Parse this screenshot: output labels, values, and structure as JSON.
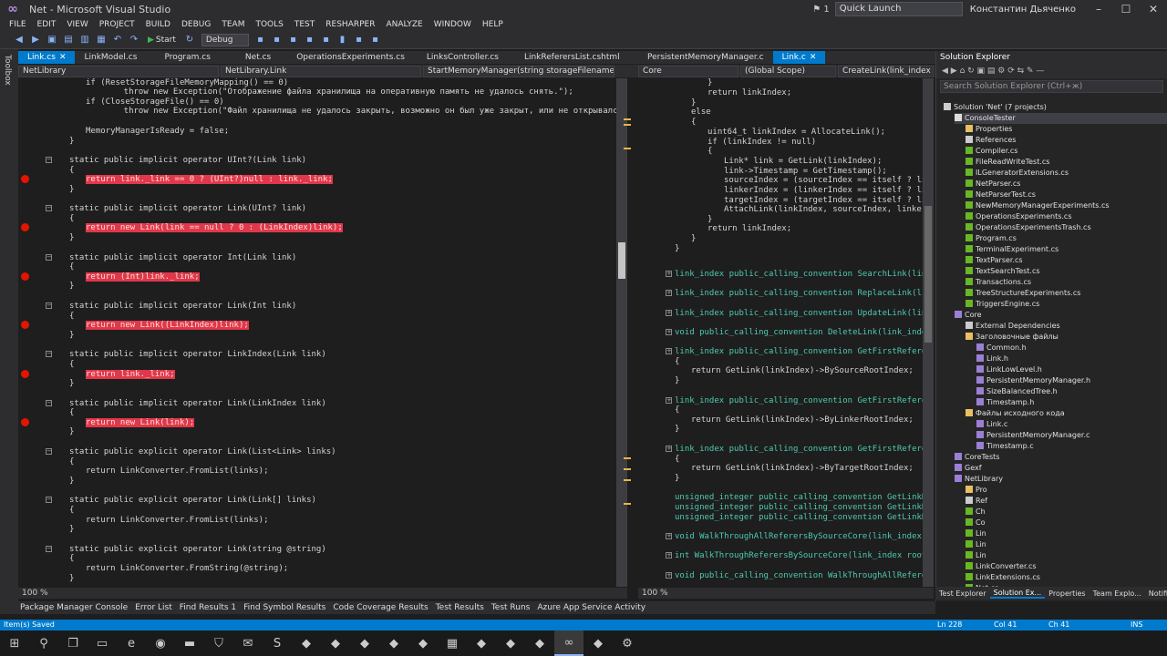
{
  "window": {
    "title": "Net - Microsoft Visual Studio",
    "notifications": "1",
    "quick_launch": "Quick Launch",
    "user": "Константин Дьяченко",
    "min": "–",
    "max": "☐",
    "close": "✕"
  },
  "menu": [
    "FILE",
    "EDIT",
    "VIEW",
    "PROJECT",
    "BUILD",
    "DEBUG",
    "TEAM",
    "TOOLS",
    "TEST",
    "RESHARPER",
    "ANALYZE",
    "WINDOW",
    "HELP"
  ],
  "toolbar": {
    "start_label": "Start",
    "config": "Debug"
  },
  "toolbox_label": "Toolbox",
  "left_tabs": [
    {
      "label": "Link.cs",
      "active": true
    },
    {
      "label": "LinkModel.cs",
      "active": false
    },
    {
      "label": "Program.cs",
      "active": false
    },
    {
      "label": "Net.cs",
      "active": false
    },
    {
      "label": "OperationsExperiments.cs",
      "active": false
    },
    {
      "label": "LinksController.cs",
      "active": false
    },
    {
      "label": "LinkReferersList.cshtml",
      "active": false
    }
  ],
  "left_nav": {
    "project": "NetLibrary",
    "type": "NetLibrary.Link",
    "member": "StartMemoryManager(string storageFilename)"
  },
  "right_tabs": [
    {
      "label": "PersistentMemoryManager.c",
      "active": false
    },
    {
      "label": "Link.c",
      "active": true
    }
  ],
  "right_nav": {
    "project": "Core",
    "scope": "(Global Scope)",
    "member": "CreateLink(link_index so"
  },
  "left_code": [
    "if (ResetStorageFileMemoryMapping() == 0)",
    "    throw new Exception(\"Отображение файла хранилища на оперативную память не удалось снять.\");",
    "if (CloseStorageFile() == 0)",
    "    throw new Exception(\"Файл хранилища не удалось закрыть, возможно он был уже закрыт, или не открывался вовсе.\");",
    "MemoryManagerIsReady = false;",
    "}",
    "static public implicit operator UInt?(Link link)",
    "{",
    "return link._link == 0 ? (UInt?)null : link._link;",
    "}",
    "static public implicit operator Link(UInt? link)",
    "{",
    "return new Link(link == null ? 0 : (LinkIndex)link);",
    "}",
    "static public implicit operator Int(Link link)",
    "{",
    "return (Int)link._link;",
    "}",
    "static public implicit operator Link(Int link)",
    "{",
    "return new Link((LinkIndex)link);",
    "}",
    "static public implicit operator LinkIndex(Link link)",
    "{",
    "return link._link;",
    "}",
    "static public implicit operator Link(LinkIndex link)",
    "{",
    "return new Link(link);",
    "}",
    "static public explicit operator Link(List<Link> links)",
    "{",
    "return LinkConverter.FromList(links);",
    "}",
    "static public explicit operator Link(Link[] links)",
    "{",
    "return LinkConverter.FromList(links);",
    "}",
    "static public explicit operator Link(string @string)",
    "{",
    "return LinkConverter.FromString(@string);",
    "}"
  ],
  "right_code": [
    "}",
    "return linkIndex;",
    "}",
    "else",
    "{",
    "uint64_t linkIndex = AllocateLink();",
    "if (linkIndex != null)",
    "{",
    "Link* link = GetLink(linkIndex);",
    "link->Timestamp = GetTimestamp();",
    "sourceIndex = (sourceIndex == itself ? linkInd",
    "linkerIndex = (linkerIndex == itself ? linkInd",
    "targetIndex = (targetIndex == itself ? linkInd",
    "AttachLink(linkIndex, sourceIndex, linkerIndex",
    "}",
    "return linkIndex;",
    "}",
    "}",
    "link_index public_calling_convention SearchLink(link_index",
    "link_index public_calling_convention ReplaceLink(link_inde",
    "link_index public_calling_convention UpdateLink(link_index",
    "void public_calling_convention DeleteLink(link_index linkI",
    "link_index public_calling_convention GetFirstRefererBySour",
    "{",
    "return GetLink(linkIndex)->BySourceRootIndex;",
    "}",
    "link_index public_calling_convention GetFirstRefererByLink",
    "{",
    "return GetLink(linkIndex)->ByLinkerRootIndex;",
    "}",
    "link_index public_calling_convention GetFirstRefererByTarg",
    "{",
    "return GetLink(linkIndex)->ByTargetRootIndex;",
    "}",
    "unsigned_integer public_calling_convention GetLinkNumberOf",
    "unsigned_integer public_calling_convention GetLinkNumberOf",
    "unsigned_integer public_calling_convention GetLinkNumberOf",
    "void WalkThroughAllReferersBySourceCore(link_index rootInd",
    "int WalkThroughReferersBySourceCore(link_index rootIndex,",
    "void public_calling_convention WalkThroughAllReferersBySou"
  ],
  "zoom_left": "100 %",
  "zoom_right": "100 %",
  "solution": {
    "title": "Solution Explorer",
    "search_placeholder": "Search Solution Explorer (Ctrl+ж)",
    "items": [
      "Solution 'Net' (7 projects)",
      "ConsoleTester",
      "Properties",
      "References",
      "Compiler.cs",
      "FileReadWriteTest.cs",
      "ILGeneratorExtensions.cs",
      "NetParser.cs",
      "NetParserTest.cs",
      "NewMemoryManagerExperiments.cs",
      "OperationsExperiments.cs",
      "OperationsExperimentsTrash.cs",
      "Program.cs",
      "TerminalExperiment.cs",
      "TextParser.cs",
      "TextSearchTest.cs",
      "Transactions.cs",
      "TreeStructureExperiments.cs",
      "TriggersEngine.cs",
      "Core",
      "External Dependencies",
      "Заголовочные файлы",
      "Common.h",
      "Link.h",
      "LinkLowLevel.h",
      "PersistentMemoryManager.h",
      "SizeBalancedTree.h",
      "Timestamp.h",
      "Файлы исходного кода",
      "Link.c",
      "PersistentMemoryManager.c",
      "Timestamp.c",
      "CoreTests",
      "Gexf",
      "NetLibrary",
      "Pro",
      "Ref",
      "Ch",
      "Co",
      "Lin",
      "Lin",
      "Lin",
      "LinkConverter.cs",
      "LinkExtensions.cs",
      "Net.cs"
    ]
  },
  "right_panel_tabs": [
    "Test Explorer",
    "Solution Ex...",
    "Properties",
    "Team Explo...",
    "Notifications"
  ],
  "bottom_tabs": [
    "Package Manager Console",
    "Error List",
    "Find Results 1",
    "Find Symbol Results",
    "Code Coverage Results",
    "Test Results",
    "Test Runs",
    "Azure App Service Activity"
  ],
  "status": {
    "message": "Item(s) Saved",
    "ln": "Ln 228",
    "col": "Col 41",
    "ch": "Ch 41",
    "mode": "INS"
  },
  "taskbar_icons": [
    "windows-start-icon",
    "search-icon",
    "task-view-icon",
    "explorer-icon",
    "edge-icon",
    "chrome-icon",
    "folder-icon",
    "store-icon",
    "mail-icon",
    "skype-icon",
    "app-icon",
    "app-icon",
    "app-icon",
    "app-icon",
    "app-icon",
    "calculator-icon",
    "app-icon",
    "app-icon",
    "app-icon",
    "visual-studio-icon",
    "app-icon",
    "settings-icon"
  ]
}
